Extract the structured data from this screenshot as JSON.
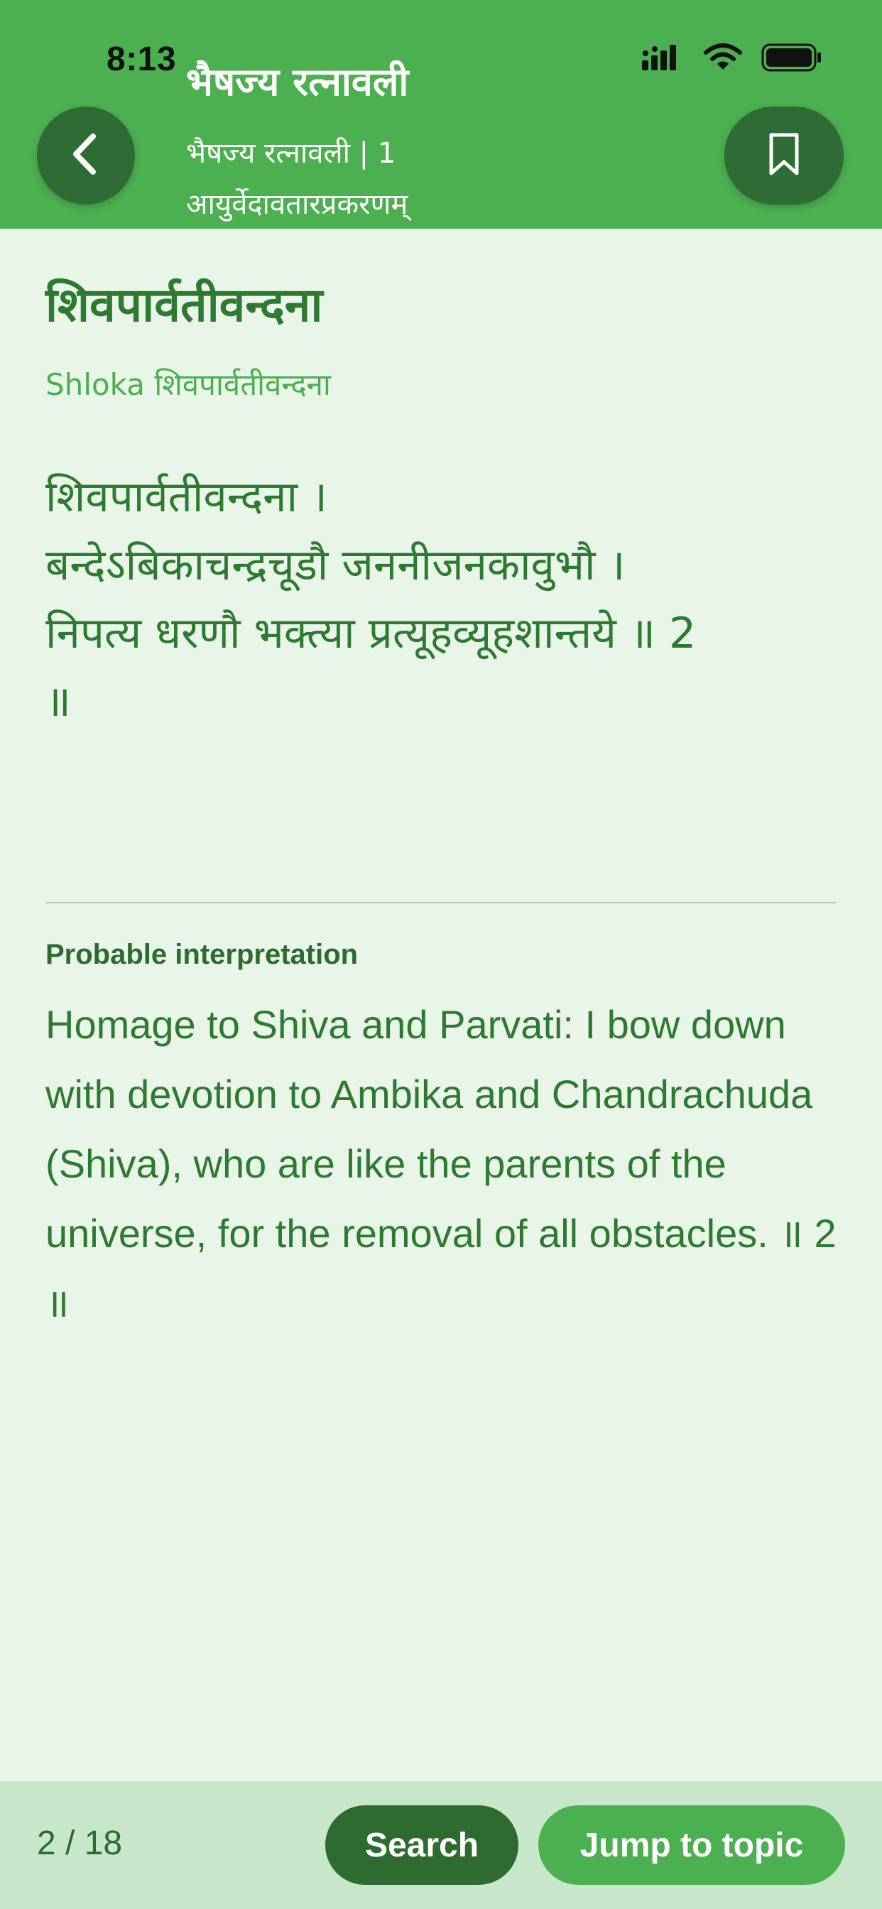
{
  "status_bar": {
    "time": "8:13",
    "icons": [
      "cellular-signal-icon",
      "wifi-icon",
      "battery-icon"
    ]
  },
  "header": {
    "app_title": "भैषज्य रत्नावली",
    "subtitle_line1": "भैषज्य रत्नावली | 1",
    "subtitle_line2": "आयुर्वेदावतारप्रकरणम्",
    "back_icon": "chevron-left-icon",
    "bookmark_icon": "bookmark-icon"
  },
  "content": {
    "topic_title": "शिवपार्वतीवन्दना",
    "shloka_label": "Shloka शिवपार्वतीवन्दना",
    "verse_lines": [
      "शिवपार्वतीवन्दना ।",
      "बन्देऽबिकाचन्द्रचूडौ जननीजनकावुभौ ।",
      "निपत्य धरणौ भक्त्या प्रत्यूहव्यूहशान्तये ॥ 2",
      "॥"
    ],
    "interpretation_label": "Probable interpretation",
    "interpretation_text": "Homage to Shiva and Parvati: I bow down with devotion to Ambika and Chandrachuda (Shiva), who are like the parents of the universe, for the removal of all obstacles. ॥ 2 ॥"
  },
  "footer": {
    "page_counter": "2 / 18",
    "search_label": "Search",
    "jump_label": "Jump to topic"
  },
  "colors": {
    "header_bg": "#4caf50",
    "page_bg": "#eaf5ea",
    "text_green": "#2e7a32",
    "dark_button": "#2e6b31",
    "footer_bg": "#c8e6c9"
  }
}
